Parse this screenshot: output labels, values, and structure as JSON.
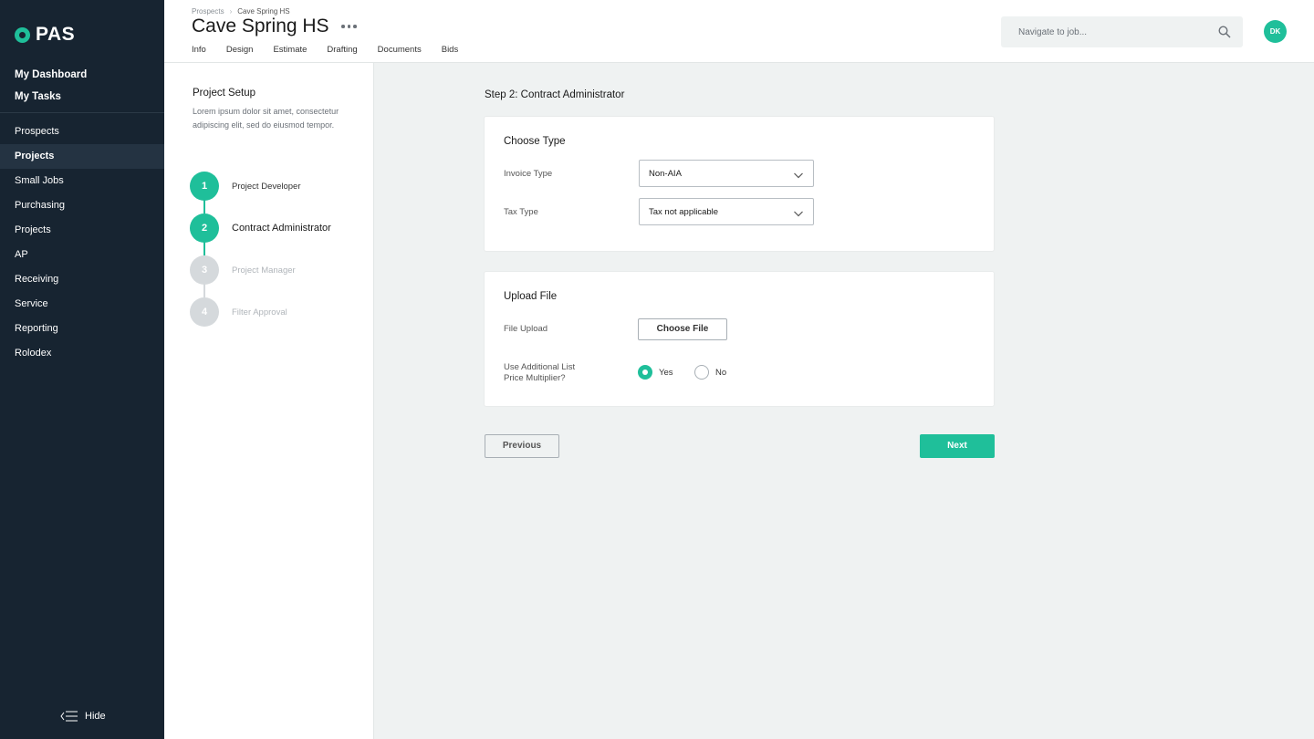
{
  "brand": {
    "name": "PAS",
    "accent": "#1fbf9a",
    "sidebar_bg": "#172431"
  },
  "sidebar": {
    "top_items": [
      {
        "label": "My Dashboard"
      },
      {
        "label": "My Tasks"
      }
    ],
    "nav_items": [
      {
        "label": "Prospects"
      },
      {
        "label": "Projects",
        "active": true
      },
      {
        "label": "Small Jobs"
      },
      {
        "label": "Purchasing"
      },
      {
        "label": "Projects"
      },
      {
        "label": "AP"
      },
      {
        "label": "Receiving"
      },
      {
        "label": "Service"
      },
      {
        "label": "Reporting"
      },
      {
        "label": "Rolodex"
      }
    ],
    "hide_label": "Hide",
    "hide_icon": "collapse-menu-icon"
  },
  "header": {
    "breadcrumb": [
      "Prospects",
      "Cave Spring HS"
    ],
    "title": "Cave Spring HS",
    "more_icon": "more-horizontal-icon",
    "tabs": [
      "Info",
      "Design",
      "Estimate",
      "Drafting",
      "Documents",
      "Bids"
    ],
    "search": {
      "placeholder": "Navigate to job...",
      "icon": "search-icon"
    },
    "avatar_initials": "DK"
  },
  "steps_panel": {
    "title": "Project Setup",
    "description": "Lorem ipsum dolor sit amet, consectetur adipiscing elit, sed do eiusmod tempor.",
    "steps": [
      {
        "number": "1",
        "label": "Project Developer",
        "state": "complete"
      },
      {
        "number": "2",
        "label": "Contract Administrator",
        "state": "active"
      },
      {
        "number": "3",
        "label": "Project Manager",
        "state": "pending"
      },
      {
        "number": "4",
        "label": "Filter Approval",
        "state": "pending"
      }
    ]
  },
  "main": {
    "step_heading": "Step 2: Contract Administrator",
    "choose_type": {
      "title": "Choose Type",
      "invoice_type": {
        "label": "Invoice Type",
        "value": "Non-AIA"
      },
      "tax_type": {
        "label": "Tax Type",
        "value": "Tax not applicable"
      }
    },
    "upload_file": {
      "title": "Upload File",
      "file_upload": {
        "label": "File Upload",
        "button": "Choose File"
      },
      "multiplier": {
        "label_line1": "Use Additional List",
        "label_line2": "Price Multiplier?",
        "options": [
          {
            "label": "Yes",
            "selected": true
          },
          {
            "label": "No",
            "selected": false
          }
        ]
      }
    },
    "previous_label": "Previous",
    "next_label": "Next"
  }
}
